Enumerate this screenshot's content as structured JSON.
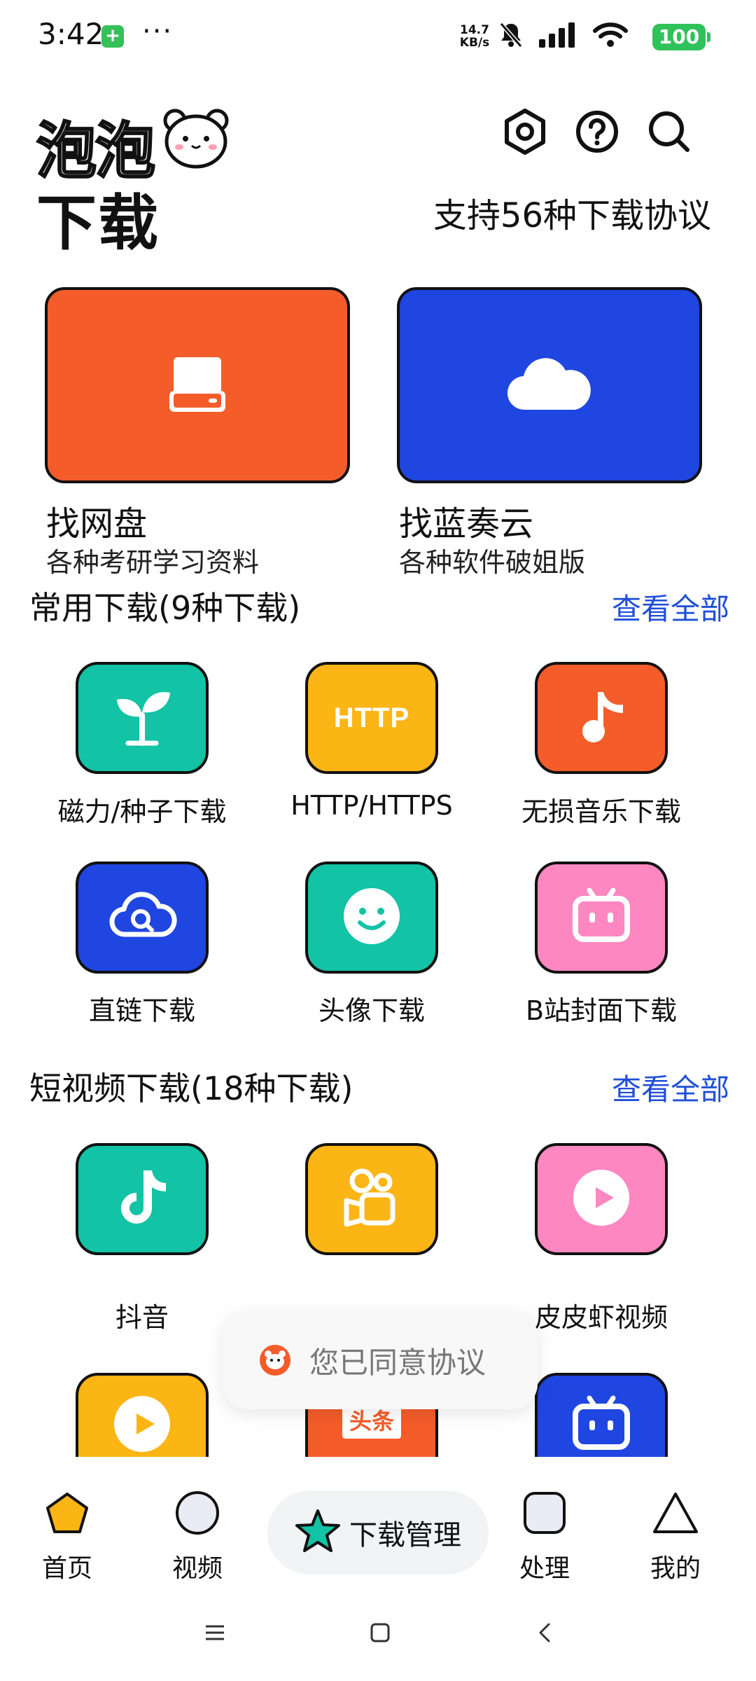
{
  "status_bar": {
    "time": "3:42",
    "badge": "+",
    "more": "···",
    "speed_value": "14.7",
    "speed_unit": "KB/s",
    "battery": "100"
  },
  "header": {
    "logo_line1": "泡泡",
    "logo_line2": "下载",
    "tagline": "支持56种下载协议",
    "icons": [
      "settings-hex-icon",
      "help-icon",
      "search-icon"
    ]
  },
  "big_cards": [
    {
      "title": "找网盘",
      "subtitle": "各种考研学习资料",
      "color": "#f45c2a",
      "icon": "drive-icon"
    },
    {
      "title": "找蓝奏云",
      "subtitle": "各种软件破姐版",
      "color": "#1f46e0",
      "icon": "cloud-icon"
    }
  ],
  "sections": {
    "common": {
      "title": "常用下载(9种下载)",
      "more": "查看全部",
      "items": [
        {
          "label": "磁力/种子下载",
          "color": "#12c3a5",
          "icon": "sprout-icon"
        },
        {
          "label": "HTTP/HTTPS",
          "color": "#fbb514",
          "icon": "http-icon",
          "icon_text": "HTTP"
        },
        {
          "label": "无损音乐下载",
          "color": "#f45c2a",
          "icon": "music-note-icon"
        },
        {
          "label": "直链下载",
          "color": "#1f46e0",
          "icon": "cloud-search-icon"
        },
        {
          "label": "头像下载",
          "color": "#12c3a5",
          "icon": "smiley-icon"
        },
        {
          "label": "B站封面下载",
          "color": "#fd87c0",
          "icon": "tv-icon"
        }
      ]
    },
    "short_video": {
      "title": "短视频下载(18种下载)",
      "more": "查看全部",
      "items": [
        {
          "label": "抖音",
          "color": "#12c3a5",
          "icon": "douyin-icon"
        },
        {
          "label": "快手",
          "color": "#fbb514",
          "icon": "kuaishou-icon"
        },
        {
          "label": "皮皮虾视频",
          "color": "#fd87c0",
          "icon": "play-circle-icon"
        },
        {
          "label": "",
          "color": "#fbb514",
          "icon": "play-circle-icon"
        },
        {
          "label": "",
          "color": "#f45c2a",
          "icon": "toutiao-icon",
          "icon_text": "头条"
        },
        {
          "label": "",
          "color": "#1f46e0",
          "icon": "tv-icon"
        }
      ]
    }
  },
  "toast": {
    "text": "您已同意协议"
  },
  "bottom_nav": [
    {
      "label": "首页",
      "icon": "pentagon-icon",
      "color": "#fbb514"
    },
    {
      "label": "视频",
      "icon": "circle-icon",
      "color": "#e9ecf4"
    },
    {
      "label": "下载管理",
      "icon": "star-icon",
      "color": "#12c3a5"
    },
    {
      "label": "处理",
      "icon": "rounded-square-icon",
      "color": "#e9ecf4"
    },
    {
      "label": "我的",
      "icon": "triangle-icon",
      "color": "#ffffff"
    }
  ]
}
